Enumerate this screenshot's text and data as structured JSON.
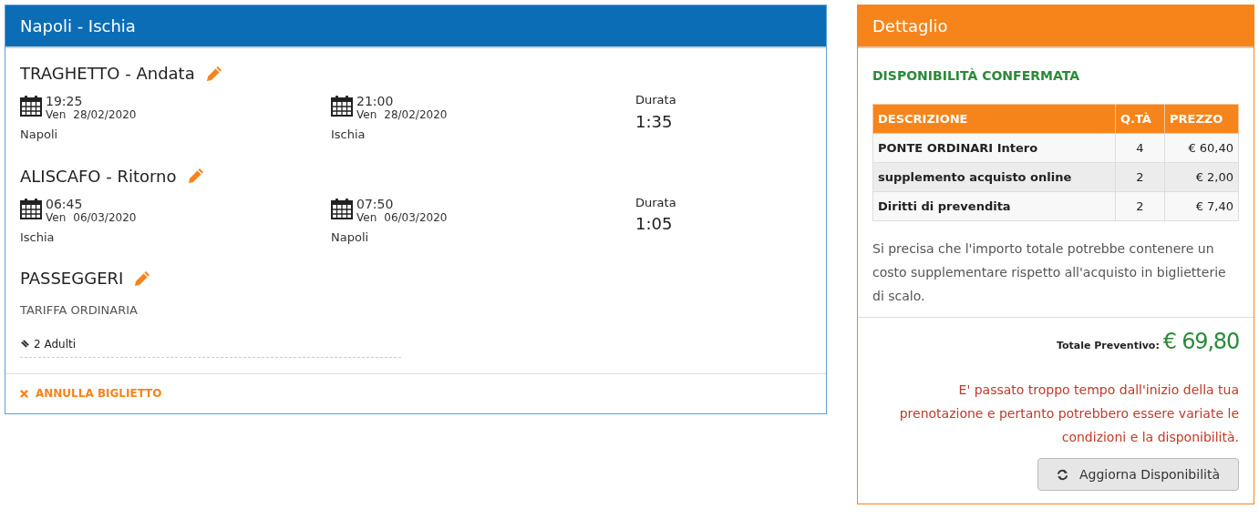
{
  "trip_panel": {
    "title": "Napoli - Ischia",
    "legs": [
      {
        "title": "TRAGHETTO - Andata",
        "departure": {
          "time": "19:25",
          "day": "Ven",
          "date": "28/02/2020",
          "place": "Napoli"
        },
        "arrival": {
          "time": "21:00",
          "day": "Ven",
          "date": "28/02/2020",
          "place": "Ischia"
        },
        "duration_label": "Durata",
        "duration": "1:35"
      },
      {
        "title": "ALISCAFO - Ritorno",
        "departure": {
          "time": "06:45",
          "day": "Ven",
          "date": "06/03/2020",
          "place": "Ischia"
        },
        "arrival": {
          "time": "07:50",
          "day": "Ven",
          "date": "06/03/2020",
          "place": "Napoli"
        },
        "duration_label": "Durata",
        "duration": "1:05"
      }
    ],
    "passengers": {
      "title": "PASSEGGERI",
      "fare": "TARIFFA ORDINARIA",
      "count": "2 Adulti"
    },
    "cancel_link": "ANNULLA BIGLIETTO"
  },
  "detail_panel": {
    "title": "Dettaglio",
    "status": "DISPONIBILITÀ CONFERMATA",
    "table": {
      "columns": [
        "DESCRIZIONE",
        "Q.TÀ",
        "PREZZO"
      ],
      "rows": [
        [
          "PONTE ORDINARI Intero",
          "4",
          "€ 60,40"
        ],
        [
          "supplemento acquisto online",
          "2",
          "€ 2,00"
        ],
        [
          "Diritti di prevendita",
          "2",
          "€ 7,40"
        ]
      ]
    },
    "note": "Si precisa che l'importo totale potrebbe contenere un costo supplementare rispetto all'acquisto in biglietterie di scalo.",
    "total_label": "Totale Preventivo:",
    "total": "€ 69,80",
    "warning": "E' passato troppo tempo dall'inizio della tua prenotazione e pertanto potrebbero essere variate le condizioni e la disponibilità.",
    "refresh_button": "Aggiorna Disponibilità"
  }
}
